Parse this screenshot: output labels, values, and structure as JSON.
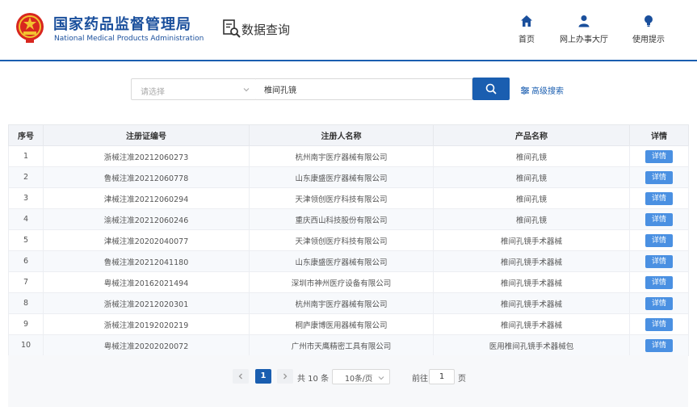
{
  "header": {
    "org_cn": "国家药品监督管理局",
    "org_en": "National Medical Products Administration",
    "query_title": "数据查询",
    "nav": [
      {
        "label": "首页",
        "icon": "home-icon"
      },
      {
        "label": "网上办事大厅",
        "icon": "user-icon"
      },
      {
        "label": "使用提示",
        "icon": "bulb-icon"
      }
    ]
  },
  "search": {
    "select_placeholder": "请选择",
    "keyword": "椎间孔镜",
    "advanced_label": "高级搜索"
  },
  "table": {
    "columns": [
      "序号",
      "注册证编号",
      "注册人名称",
      "产品名称",
      "详情"
    ],
    "detail_label": "详情",
    "rows": [
      {
        "no": "1",
        "reg": "浙械注准20212060273",
        "company": "杭州南宇医疗器械有限公司",
        "product": "椎间孔镜"
      },
      {
        "no": "2",
        "reg": "鲁械注准20212060778",
        "company": "山东康盛医疗器械有限公司",
        "product": "椎间孔镜"
      },
      {
        "no": "3",
        "reg": "津械注准20212060294",
        "company": "天津领创医疗科技有限公司",
        "product": "椎间孔镜"
      },
      {
        "no": "4",
        "reg": "渝械注准20212060246",
        "company": "重庆西山科技股份有限公司",
        "product": "椎间孔镜"
      },
      {
        "no": "5",
        "reg": "津械注准20202040077",
        "company": "天津领创医疗科技有限公司",
        "product": "椎间孔镜手术器械"
      },
      {
        "no": "6",
        "reg": "鲁械注准20212041180",
        "company": "山东康盛医疗器械有限公司",
        "product": "椎间孔镜手术器械"
      },
      {
        "no": "7",
        "reg": "粤械注准20162021494",
        "company": "深圳市神州医疗设备有限公司",
        "product": "椎间孔镜手术器械"
      },
      {
        "no": "8",
        "reg": "浙械注准20212020301",
        "company": "杭州南宇医疗器械有限公司",
        "product": "椎间孔镜手术器械"
      },
      {
        "no": "9",
        "reg": "浙械注准20192020219",
        "company": "桐庐康博医用器械有限公司",
        "product": "椎间孔镜手术器械"
      },
      {
        "no": "10",
        "reg": "粤械注准20202020072",
        "company": "广州市天鹰精密工具有限公司",
        "product": "医用椎间孔镜手术器械包"
      }
    ]
  },
  "pagination": {
    "current": "1",
    "total_text": "共 10 条",
    "page_size": "10条/页",
    "goto_label": "前往",
    "goto_value": "1",
    "page_suffix": "页"
  },
  "colors": {
    "brand": "#1a5eb0",
    "detail_button": "#4a90e2"
  }
}
